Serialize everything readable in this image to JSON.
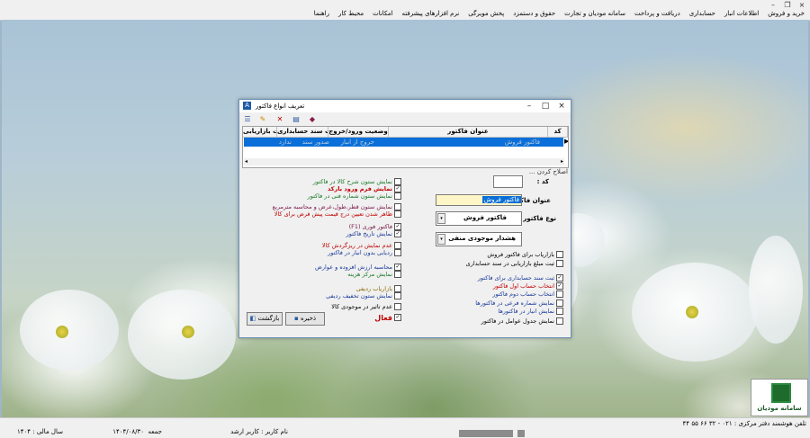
{
  "menu": [
    "خرید و فروش",
    "اطلاعات انبار",
    "حسابداری",
    "دریافت و پرداخت",
    "سامانه مودیان و تجارت",
    "حقوق و دستمزد",
    "پخش مویرگی",
    "نرم افزارهای پیشرفته",
    "امکانات",
    "محیط کار",
    "راهنما"
  ],
  "window": {
    "title": "تعریف انواع فاکتور",
    "grid": {
      "columns": [
        "کد",
        "عنوان فاکتور",
        "وضعیت ورود/خروج",
        "وضعیت سند حسابداری",
        "وضعیت بازاریابی"
      ],
      "row": {
        "code": "",
        "title": "فاکتور فروش",
        "io": "خروج از انبار",
        "acc": "صدور سند",
        "mkt": "ندارد"
      }
    },
    "edit_note": "اصلاح کردن ...",
    "form": {
      "code_label": "کد :",
      "code_value": "",
      "title_label": "عنوان فاکتور :",
      "title_value": "فاکتور فروش",
      "type_label": "نوع فاکتور :",
      "type_value": "فاکتور فروش",
      "warning_value": "هشدار موجودی منفی"
    },
    "right_checks": [
      {
        "label": "بازاریاب برای فاکتور فروش",
        "checked": false
      },
      {
        "label": "ثبت مبلغ بازاریابی در سند حسابداری",
        "checked": false
      },
      {
        "label": "ثبت سند حسابداری برای فاکتور",
        "checked": true
      },
      {
        "label": "انتخاب حساب اول فاکتور",
        "checked": true
      },
      {
        "label": "انتخاب حساب دوم فاکتور",
        "checked": false
      },
      {
        "label": "نمایش شماره فرعی در فاکتورها",
        "checked": false
      },
      {
        "label": "نمایش انبار در فاکتورها",
        "checked": false
      },
      {
        "label": "نمایش جدول عوامل در فاکتور",
        "checked": false
      }
    ],
    "left_checks": [
      {
        "label": "نمایش ستون شرح کالا در فاکتور",
        "checked": false
      },
      {
        "label": "نمایش فرم ورود بارکد",
        "checked": true
      },
      {
        "label": "نمایش ستون شماره فنی در فاکتور",
        "checked": false
      },
      {
        "label": "نمایش ستون قطر،طول،عرض و محاسبه مترمربع",
        "checked": false
      },
      {
        "label": "ظاهر شدن تعیین درج قیمت پیش فرض برای کالا",
        "checked": false
      },
      {
        "label": "فاکتور فوری (F1)",
        "checked": true
      },
      {
        "label": "نمایش تاریخ فاکتور",
        "checked": true
      },
      {
        "label": "عدم نمایش در ریزگردش کالا",
        "checked": false
      },
      {
        "label": "ردیابی بدون انبار در فاکتور",
        "checked": false
      },
      {
        "label": "محاسبه ارزش افزوده و عوارض",
        "checked": true
      },
      {
        "label": "نمایش مرکز هزینه",
        "checked": false
      },
      {
        "label": "بازاریاب ردیفی",
        "checked": false
      },
      {
        "label": "نمایش ستون تخفیف ردیفی",
        "checked": false
      },
      {
        "label": "عدم تاثیر در موجودی کالا",
        "checked": false
      },
      {
        "label": "فعال",
        "checked": true
      }
    ],
    "buttons": {
      "save": "ذخیره",
      "back": "بازگشت"
    }
  },
  "status": {
    "user": "نام کاربر : کاربر ارشد",
    "day": "جمعه",
    "date": "۱۴۰۴/۰۸/۳۰",
    "year": "سال مالی : ۱۴۰۴",
    "phone": "تلفن هوشمند دفتر مرکزی : ۰۲۱ - ۳۲ ۶۶ ۵۵ ۴۴",
    "logo": "سامانه مودیان"
  },
  "colors": {
    "selection": "#0a6fd8",
    "accent_green": "#1a7a28",
    "accent_red": "#c00000",
    "accent_blue": "#1a3a9a"
  }
}
